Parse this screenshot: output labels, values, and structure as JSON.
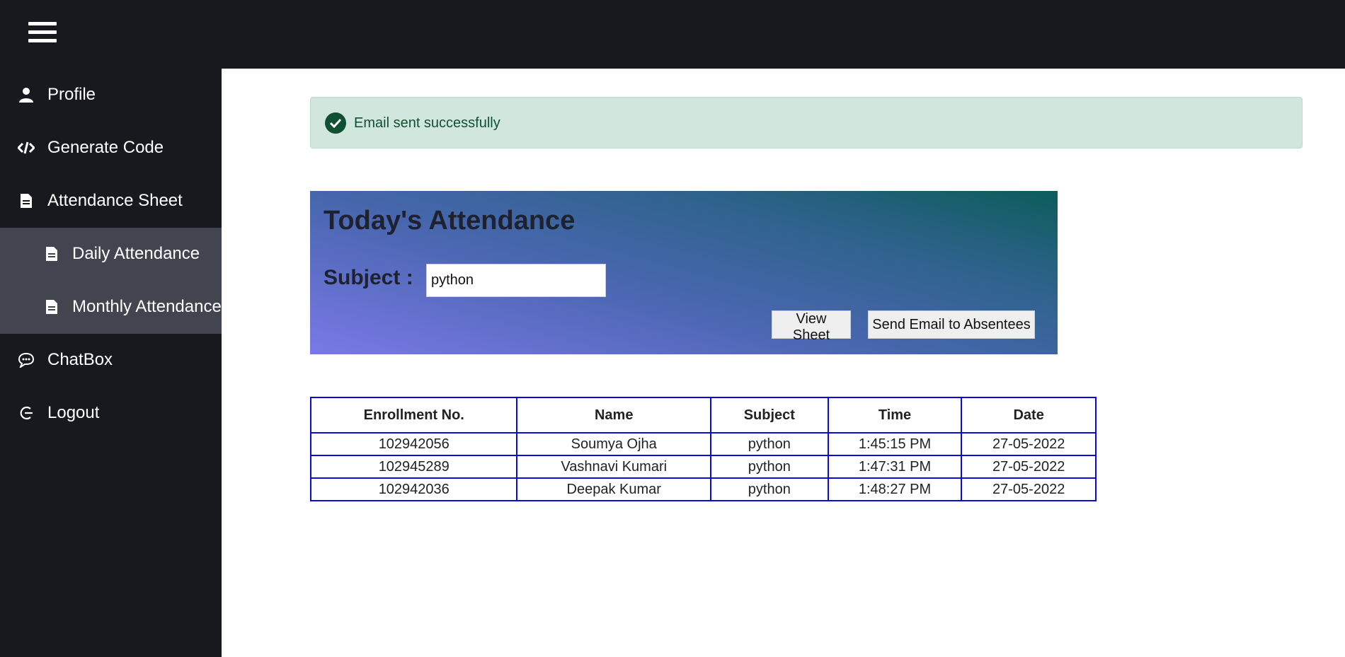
{
  "topbar": {
    "menu_icon": "hamburger-menu-icon"
  },
  "sidebar": {
    "items": [
      {
        "label": "Profile",
        "icon": "user-icon"
      },
      {
        "label": "Generate Code",
        "icon": "code-icon"
      },
      {
        "label": "Attendance Sheet",
        "icon": "document-icon"
      },
      {
        "label": "Daily Attendance",
        "icon": "document-icon"
      },
      {
        "label": "Monthly Attendance",
        "icon": "document-icon"
      },
      {
        "label": "ChatBox",
        "icon": "chat-icon"
      },
      {
        "label": "Logout",
        "icon": "logout-icon"
      }
    ]
  },
  "alert": {
    "message": "Email sent successfully",
    "color": "#d1e7dd"
  },
  "panel": {
    "title": "Today's Attendance",
    "subject_label": "Subject :",
    "subject_value": "python",
    "view_button": "View Sheet",
    "send_button": "Send Email to Absentees"
  },
  "table": {
    "headers": [
      "Enrollment No.",
      "Name",
      "Subject",
      "Time",
      "Date"
    ],
    "rows": [
      [
        "102942056",
        "Soumya Ojha",
        "python",
        "1:45:15 PM",
        "27-05-2022"
      ],
      [
        "102945289",
        "Vashnavi Kumari",
        "python",
        "1:47:31 PM",
        "27-05-2022"
      ],
      [
        "102942036",
        "Deepak Kumar",
        "python",
        "1:48:27 PM",
        "27-05-2022"
      ]
    ],
    "border_color": "#0b0bd6"
  },
  "colors": {
    "sidebar": "#18191f",
    "sidebar_sub": "#42444f"
  }
}
